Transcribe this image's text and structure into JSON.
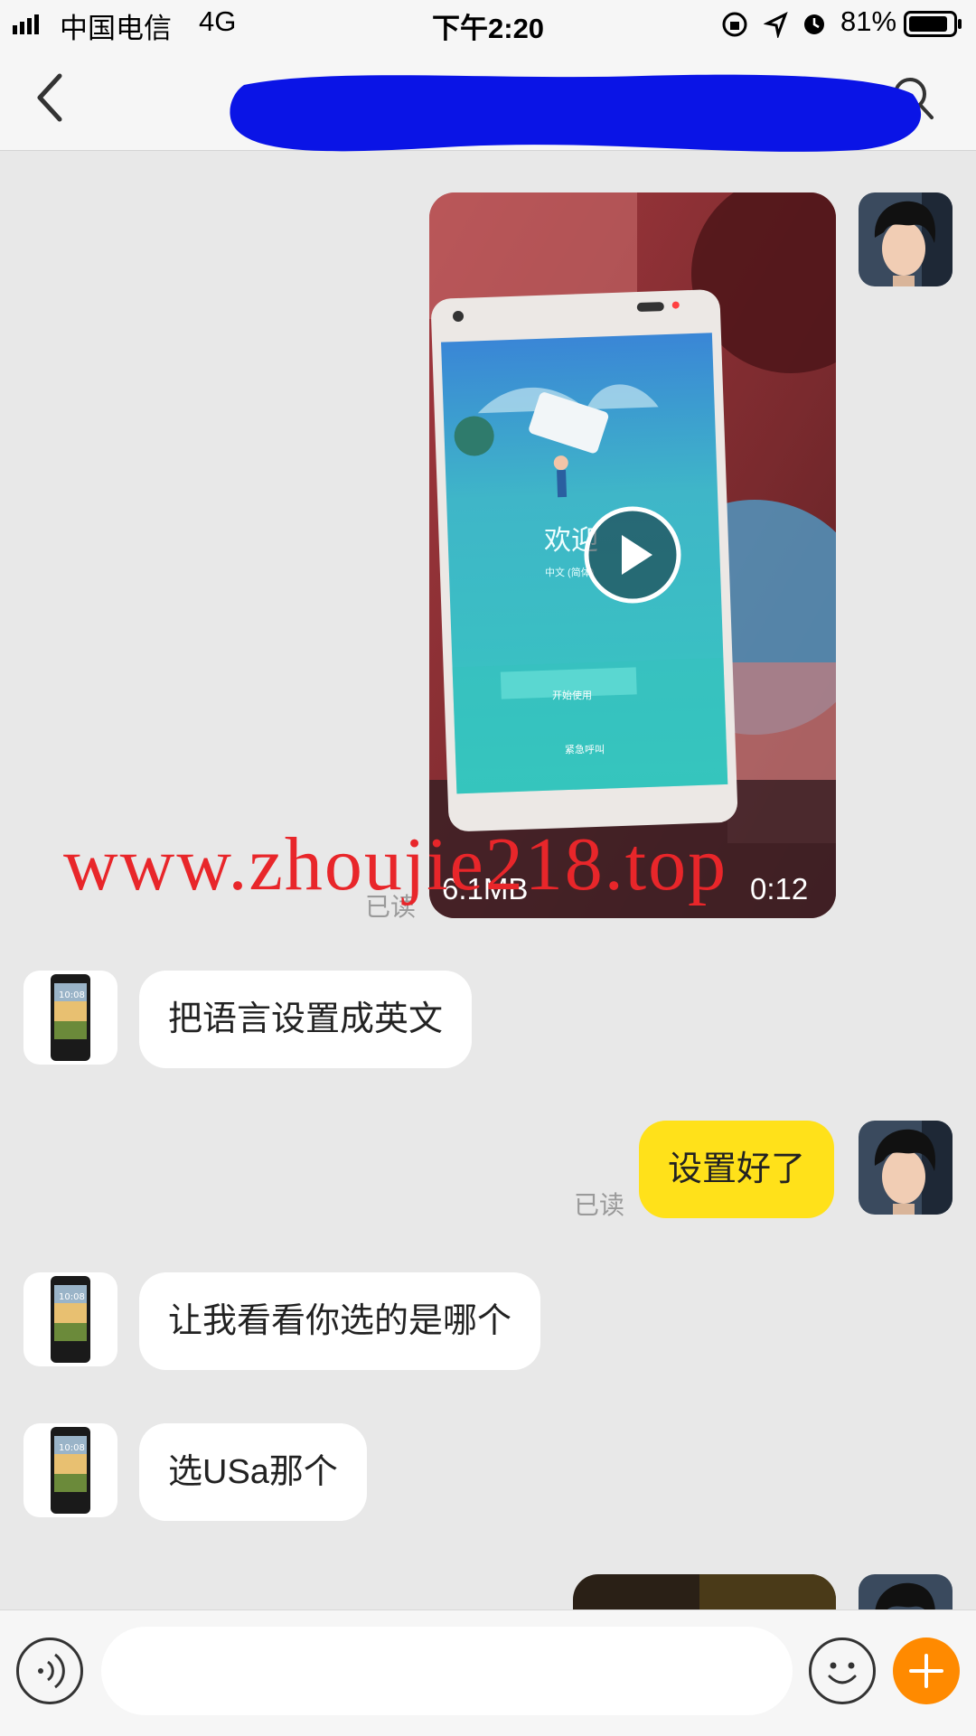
{
  "status_bar": {
    "carrier": "中国电信",
    "network": "4G",
    "time": "下午2:20",
    "battery": "81%"
  },
  "nav": {
    "title": ""
  },
  "messages": [
    {
      "type": "video",
      "side": "right",
      "size": "6.1MB",
      "duration": "0:12",
      "read": "已读"
    },
    {
      "type": "text",
      "side": "left",
      "text": "把语言设置成英文"
    },
    {
      "type": "text",
      "side": "right",
      "text": "设置好了",
      "read": "已读"
    },
    {
      "type": "text",
      "side": "left",
      "text": "让我看看你选的是哪个"
    },
    {
      "type": "text",
      "side": "left",
      "text": "选USa那个"
    }
  ],
  "video_screen": {
    "welcome": "欢迎",
    "language": "中文 (简体)",
    "start_button": "开始使用",
    "emergency": "紧急呼叫"
  },
  "watermark": "www.zhoujie218.top",
  "input": {
    "placeholder": ""
  },
  "colors": {
    "accent": "#ffe11a",
    "plus": "#ff8a00",
    "background": "#e8e8e8"
  },
  "icons": [
    "signal-icon",
    "back-icon",
    "search-icon",
    "play-icon",
    "voice-icon",
    "emoji-icon",
    "plus-icon",
    "battery-icon",
    "alarm-icon",
    "location-icon",
    "lock-rotation-icon"
  ]
}
